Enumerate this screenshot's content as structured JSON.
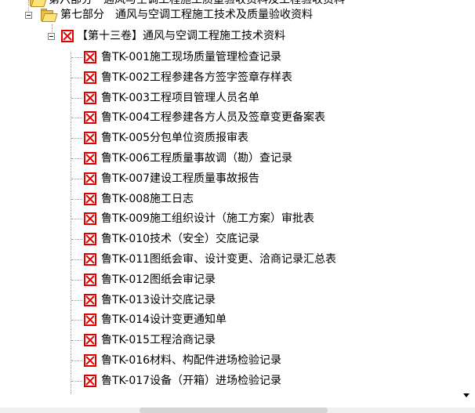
{
  "tree": {
    "partial_top": "第六部分　通风与空调工程施工质量验收资料及工程验收资料",
    "section": "第七部分　通风与空调工程施工技术及质量验收资料",
    "volume": "【第十三卷】通风与空调工程施工技术资料",
    "items": [
      "鲁TK-001施工现场质量管理检查记录",
      "鲁TK-002工程参建各方签字签章存样表",
      "鲁TK-003工程项目管理人员名单",
      "鲁TK-004工程参建各方人员及签章变更备案表",
      "鲁TK-005分包单位资质报审表",
      "鲁TK-006工程质量事故调（勘）查记录",
      "鲁TK-007建设工程质量事故报告",
      "鲁TK-008施工日志",
      "鲁TK-009施工组织设计（施工方案）审批表",
      "鲁TK-010技术（安全）交底记录",
      "鲁TK-011图纸会审、设计变更、洽商记录汇总表",
      "鲁TK-012图纸会审记录",
      "鲁TK-013设计交底记录",
      "鲁TK-014设计变更通知单",
      "鲁TK-015工程洽商记录",
      "鲁TK-016材料、构配件进场检验记录",
      "鲁TK-017设备（开箱）进场检验记录"
    ]
  },
  "icons": {
    "folder": "folder-open-icon",
    "document": "broken-document-icon"
  },
  "colors": {
    "icon_red": "#e00000",
    "folder_yellow": "#e8c04a"
  }
}
